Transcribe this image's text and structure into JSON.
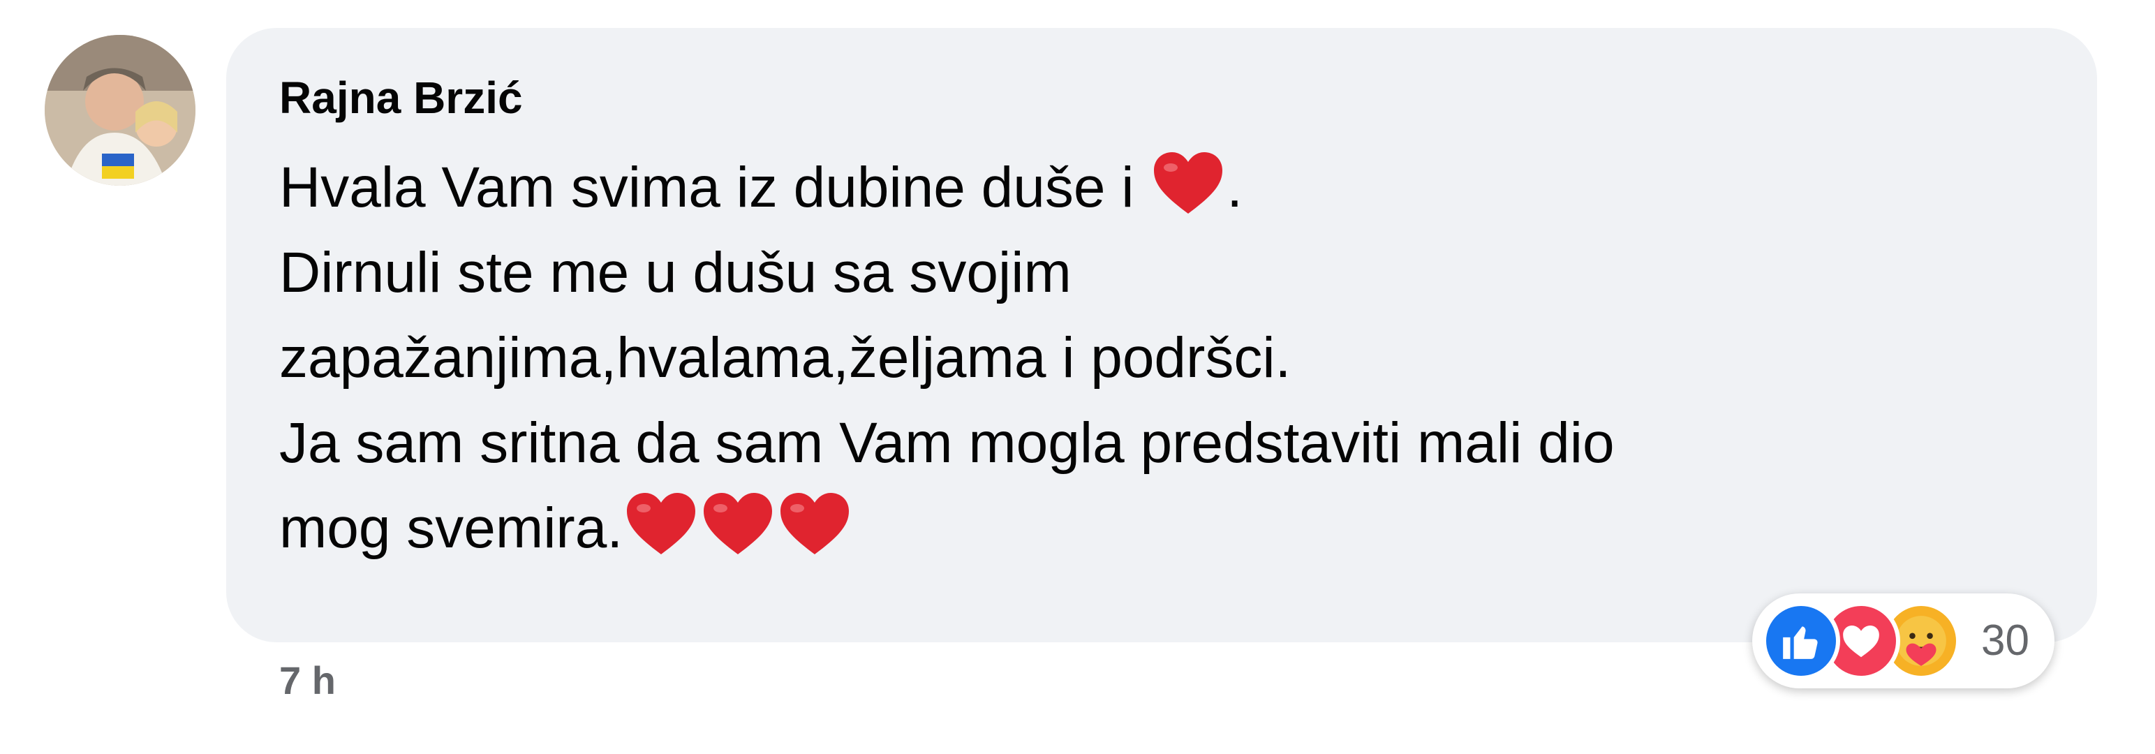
{
  "comment": {
    "author": "Rajna Brzić",
    "lines": [
      "Hvala Vam svima iz dubine duše i",
      "Dirnuli ste me u dušu sa svojim",
      "zapažanjima,hvalama,željama i podršci.",
      "Ja sam sritna da sam Vam mogla predstaviti mali dio",
      "mog svemira."
    ],
    "line1_suffix": ".",
    "timestamp": "7 h",
    "reactions": {
      "icons": [
        "like-icon",
        "love-icon",
        "care-icon"
      ],
      "count": "30"
    },
    "colors": {
      "bubble": "#f0f2f5",
      "like": "#1877f2",
      "love": "#f33e58",
      "care": "#f7b125",
      "heart": "#e0242f"
    }
  }
}
